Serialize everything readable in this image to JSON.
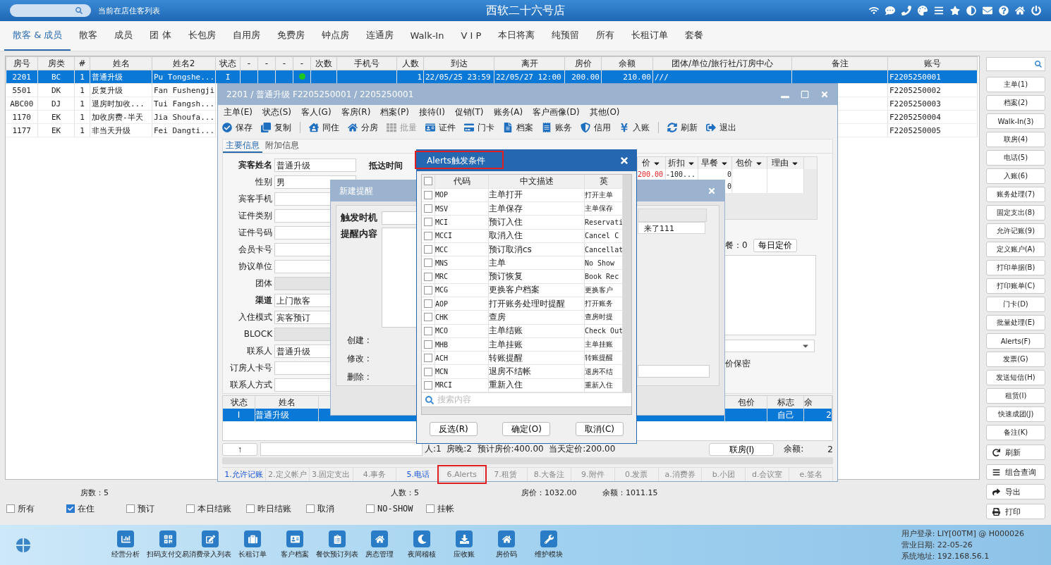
{
  "topbar": {
    "caption": "当前在店住客列表",
    "title": "西软二十六号店"
  },
  "tabs": [
    {
      "label": "散客 & 成员",
      "selected": true
    },
    {
      "label": "散客",
      "selected": false
    },
    {
      "label": "成员",
      "selected": false
    },
    {
      "label": "团 体",
      "selected": false
    },
    {
      "label": "长包房",
      "selected": false
    },
    {
      "label": "自用房",
      "selected": false
    },
    {
      "label": "免费房",
      "selected": false
    },
    {
      "label": "钟点房",
      "selected": false
    },
    {
      "label": "连通房",
      "selected": false
    },
    {
      "label": "Walk-In",
      "selected": false
    },
    {
      "label": "V I P",
      "selected": false
    },
    {
      "label": "本日将离",
      "selected": false
    },
    {
      "label": "纯预留",
      "selected": false
    },
    {
      "label": "所有",
      "selected": false
    },
    {
      "label": "长租订单",
      "selected": false
    },
    {
      "label": "套餐",
      "selected": false
    }
  ],
  "guest_table": {
    "columns": [
      "房号",
      "房类",
      "#",
      "姓名",
      "姓名2",
      "状态",
      "-",
      "-",
      "-",
      "-",
      "次数",
      "手机号",
      "人数",
      "到达",
      "离开",
      "房价",
      "余额",
      "团体/单位/旅行社/订房中心",
      "备注",
      "账号"
    ],
    "rows": [
      {
        "room": "2201",
        "type": "BC",
        "no": "1",
        "name": "普通升级",
        "name2": "Pu Tongshe...",
        "status": "I",
        "indicator": true,
        "guests": "1",
        "arrive": "22/05/25 23:59",
        "depart": "22/05/27 12:00",
        "rate": "200.00",
        "balance": "210.00",
        "group": "///",
        "account": "F2205250001",
        "selected": true
      },
      {
        "room": "5501",
        "type": "DK",
        "no": "1",
        "name": "反复升级",
        "name2": "Fan Fushengji",
        "account": "F2205250002",
        "selected": false
      },
      {
        "room": "ABC00",
        "type": "DJ",
        "no": "1",
        "name": "退房时加收...",
        "name2": "Tui Fangsh...",
        "account": "F2205250003",
        "selected": false
      },
      {
        "room": "1170",
        "type": "EK",
        "no": "1",
        "name": "加收房费-半天",
        "name2": "Jia Shoufa...",
        "account": "F2205250004",
        "selected": false
      },
      {
        "room": "1177",
        "type": "EK",
        "no": "1",
        "name": "非当天升级",
        "name2": "Fei Dangti...",
        "account": "F2205250005",
        "selected": false
      }
    ]
  },
  "summary": [
    "房数：5",
    "人数：5",
    "房价：1032.00",
    "余额：1011.15"
  ],
  "filters": [
    {
      "label": "所有",
      "checked": false
    },
    {
      "label": "在住",
      "checked": true
    },
    {
      "label": "预订",
      "checked": false
    },
    {
      "label": "本日结账",
      "checked": false
    },
    {
      "label": "昨日结账",
      "checked": false
    },
    {
      "label": "取消",
      "checked": false
    },
    {
      "label": "NO-SHOW",
      "checked": false
    },
    {
      "label": "挂帐",
      "checked": false
    }
  ],
  "sidebar": {
    "buttons": [
      "主单(1)",
      "档案(2)",
      "Walk-In(3)",
      "联房(4)",
      "电话(5)",
      "入账(6)",
      "账务处理(7)",
      "固定支出(8)",
      "允许记账(9)",
      "定义账户(A)",
      "打印单据(B)",
      "打印账单(C)",
      "门卡(D)",
      "批量处理(E)",
      "Alerts(F)",
      "发票(G)",
      "发送短信(H)",
      "租赁(I)",
      "快速成团(J)",
      "备注(K)"
    ],
    "actions": [
      "刷新",
      "组合查询",
      "导出",
      "打印"
    ]
  },
  "dock": {
    "items": [
      "经营分析",
      "扫码支付交易",
      "消费录入列表",
      "长租订单",
      "客户档案",
      "餐饮预订列表",
      "房态管理",
      "夜间稽核",
      "应收账",
      "房价码",
      "维护模块"
    ],
    "status": [
      "用户登录: LIY[00TM] @ H000026",
      "营业日期: 22-05-26",
      "系统地址: 192.168.56.1"
    ]
  },
  "folio_window": {
    "title": "2201 / 普通升级 F2205250001 / 2205250001",
    "menu": [
      "主单(E)",
      "状态(S)",
      "客人(G)",
      "客房(R)",
      "档案(P)",
      "接待(I)",
      "促销(T)",
      "账务(A)",
      "客户画像(D)",
      "其他(O)"
    ],
    "toolbar": [
      [
        {
          "label": "保存",
          "disabled": false
        },
        {
          "label": "复制",
          "disabled": false
        }
      ],
      [
        {
          "label": "同住",
          "disabled": false
        },
        {
          "label": "分房",
          "disabled": false
        },
        {
          "label": "批量",
          "disabled": true
        },
        {
          "label": "证件",
          "disabled": false
        },
        {
          "label": "门卡",
          "disabled": false
        },
        {
          "label": "档案",
          "disabled": false
        },
        {
          "label": "账务",
          "disabled": false
        },
        {
          "label": "信用",
          "disabled": false
        },
        {
          "label": "入账",
          "disabled": false
        }
      ],
      [
        {
          "label": "刷新",
          "disabled": false
        },
        {
          "label": "退出",
          "disabled": false
        }
      ]
    ],
    "tabs": [
      {
        "label": "主要信息",
        "selected": true
      },
      {
        "label": "附加信息",
        "selected": false
      }
    ],
    "form": [
      {
        "label": "宾客姓名",
        "value": "普通升级",
        "bold": true,
        "disabled": false
      },
      {
        "label": "性别",
        "value": "男",
        "bold": false,
        "disabled": false
      },
      {
        "label": "宾客手机",
        "bold": false,
        "disabled": false
      },
      {
        "label": "证件类别",
        "bold": false,
        "disabled": false
      },
      {
        "label": "证件号码",
        "bold": false,
        "disabled": false
      },
      {
        "label": "会员卡号",
        "bold": false,
        "disabled": false
      },
      {
        "label": "协议单位",
        "bold": false,
        "disabled": false
      },
      {
        "label": "团体",
        "bold": false,
        "disabled": true
      },
      {
        "label": "渠道",
        "value": "上门散客",
        "bold": true,
        "disabled": false
      },
      {
        "label": "入住模式",
        "value": "宾客预订",
        "bold": false,
        "disabled": false
      },
      {
        "label": "BLOCK",
        "bold": false,
        "disabled": true
      },
      {
        "label": "联系人",
        "value": "普通升级",
        "bold": false,
        "disabled": false
      },
      {
        "label": "订房人卡号",
        "bold": false,
        "disabled": false
      },
      {
        "label": "联系人方式",
        "bold": false,
        "disabled": false
      }
    ],
    "arrival_label": "抵达时间",
    "rates": {
      "columns": [
        "价",
        "折扣",
        "早餐",
        "包价",
        "理由"
      ],
      "rows": [
        {
          "price": "200.00",
          "discount": "-100...",
          "breakfast": "0"
        },
        {
          "breakfast": "0"
        }
      ]
    },
    "breakfast_total": "餐：0",
    "daily_rate_button": "每日定价",
    "confidential_label": "价保密",
    "guests": {
      "columns": {
        "status": "状态",
        "name": "姓名",
        "package": "包价",
        "flag": "标志",
        "balance": "余"
      },
      "rows": [
        {
          "status": "I",
          "name": "普通升级",
          "flag": "自己",
          "balance": "2",
          "selected": true
        }
      ]
    },
    "footer": {
      "up_button": "↑",
      "stats": "人:1  房晚:2  预计房价:400.00  当天定价:200.00",
      "link_button": "联房(I)",
      "balance_label": "余额:",
      "balance": "2"
    },
    "bottom_tabs": [
      {
        "label": "1.允许记账",
        "highlighted": true,
        "marked": false
      },
      {
        "label": "2.定义帐户",
        "highlighted": false,
        "marked": false
      },
      {
        "label": "3.固定支出",
        "highlighted": false,
        "marked": false
      },
      {
        "label": "4.事务",
        "highlighted": false,
        "marked": false
      },
      {
        "label": "5.电话",
        "highlighted": true,
        "marked": false
      },
      {
        "label": "6.Alerts",
        "highlighted": false,
        "marked": true
      },
      {
        "label": "7.租赁",
        "highlighted": false,
        "marked": false
      },
      {
        "label": "8.大备注",
        "highlighted": false,
        "marked": false
      },
      {
        "label": "9.附件",
        "highlighted": false,
        "marked": false
      },
      {
        "label": "0.发票",
        "highlighted": false,
        "marked": false
      },
      {
        "label": "a.消费券",
        "highlighted": false,
        "marked": false
      },
      {
        "label": "b.小团",
        "highlighted": false,
        "marked": false
      },
      {
        "label": "d.会议室",
        "highlighted": false,
        "marked": false
      },
      {
        "label": "e.签名",
        "highlighted": false,
        "marked": false
      }
    ]
  },
  "reminder_dialog": {
    "title": "新建提醒",
    "trigger_label": "触发时机",
    "content_label": "提醒内容",
    "history": [
      "创建 :",
      "修改 :",
      "删除 :"
    ],
    "list_cell": "来了111"
  },
  "alerts_dialog": {
    "title": "Alerts触发条件",
    "title_marked": true,
    "all_checked": false,
    "columns": [
      "代码",
      "中文描述",
      "英"
    ],
    "rows": [
      {
        "code": "MOP",
        "zh": "主单打开",
        "en": "打开主单",
        "checked": false
      },
      {
        "code": "MSV",
        "zh": "主单保存",
        "en": "主单保存",
        "checked": false
      },
      {
        "code": "MCI",
        "zh": "预订入住",
        "en": "Reservati",
        "checked": false
      },
      {
        "code": "MCCI",
        "zh": "取消入住",
        "en": "Cancel C",
        "checked": false
      },
      {
        "code": "MCC",
        "zh": "预订取消cs",
        "en": "Cancellat",
        "checked": false
      },
      {
        "code": "MNS",
        "zh": "主单",
        "en": "No Show",
        "checked": false
      },
      {
        "code": "MRC",
        "zh": "预订恢复",
        "en": "Book Rec",
        "checked": false
      },
      {
        "code": "MCG",
        "zh": "更换客户档案",
        "en": "更换客户",
        "checked": false
      },
      {
        "code": "AOP",
        "zh": "打开账务处理时提醒",
        "en": "打开账务",
        "checked": false
      },
      {
        "code": "CHK",
        "zh": "查房",
        "en": "查房时提",
        "checked": false
      },
      {
        "code": "MCO",
        "zh": "主单结账",
        "en": "Check Out",
        "checked": false
      },
      {
        "code": "MHB",
        "zh": "主单挂账",
        "en": "主单挂账",
        "checked": false
      },
      {
        "code": "ACH",
        "zh": "转账提醒",
        "en": "转账提醒",
        "checked": false
      },
      {
        "code": "MCN",
        "zh": "退房不结帐",
        "en": "退房不结",
        "checked": false
      },
      {
        "code": "MRCI",
        "zh": "重新入住",
        "en": "重新入住",
        "checked": false
      }
    ],
    "search_placeholder": "搜索内容",
    "buttons": [
      "反选(R)",
      "确定(O)",
      "取消(C)"
    ]
  }
}
